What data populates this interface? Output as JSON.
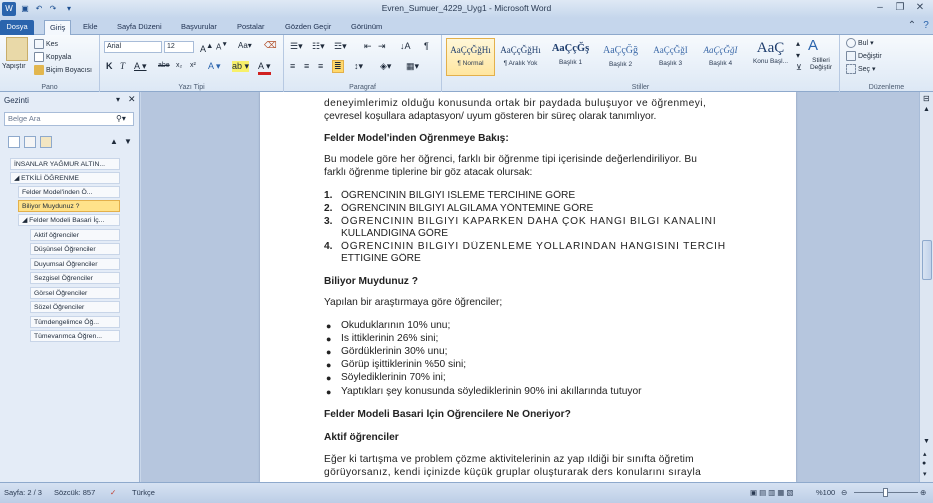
{
  "window": {
    "title": "Evren_Sumuer_4229_Uyg1 - Microsoft Word"
  },
  "qat": {
    "undo_tip": "1",
    "redo_tip": "2",
    "save_tip": "3"
  },
  "tabs": [
    {
      "label": "Dosya",
      "key": "D"
    },
    {
      "label": "Giriş",
      "key": "Ş"
    },
    {
      "label": "Ekle",
      "key": "O"
    },
    {
      "label": "Sayfa Düzeni",
      "key": "S"
    },
    {
      "label": "Başvurular",
      "key": "V"
    },
    {
      "label": "Postalar",
      "key": "L"
    },
    {
      "label": "Gözden Geçir",
      "key": "R"
    },
    {
      "label": "Görünüm",
      "key": "P"
    }
  ],
  "ribbon": {
    "clipboard": {
      "paste": "Yapıştır",
      "cut": "Kes",
      "copy": "Kopyala",
      "format_painter": "Biçim Boyacısı",
      "label": "Pano"
    },
    "font": {
      "family": "Arial",
      "size": "12",
      "label": "Yazı Tipi"
    },
    "paragraph": {
      "label": "Paragraf"
    },
    "styles": {
      "label": "Stiller",
      "items": [
        {
          "sample": "AaÇçĞğHı",
          "name": "¶ Normal"
        },
        {
          "sample": "AaÇçĞğHı",
          "name": "¶ Aralık Yok"
        },
        {
          "sample": "AaÇçĞş",
          "name": "Başlık 1"
        },
        {
          "sample": "AaÇçĞğ",
          "name": "Başlık 2"
        },
        {
          "sample": "AaÇçĞğI",
          "name": "Başlık 3"
        },
        {
          "sample": "AaÇçĞğI",
          "name": "Başlık 4"
        },
        {
          "sample": "AaÇ",
          "name": "Konu Başl..."
        }
      ],
      "change_styles": "Stilleri Değiştir"
    },
    "editing": {
      "find": "Bul",
      "replace": "Değiştir",
      "select": "Seç",
      "label": "Düzenleme"
    }
  },
  "nav": {
    "header": "Gezinti",
    "search_placeholder": "Belge Ara",
    "items": [
      "İNSANLAR YAĞMUR ALTIN...",
      "ETKİLİ ÖĞRENME",
      "Felder Model'inden Ö...",
      "Biliyor Muydunuz ?",
      "Felder Modeli Basari İç...",
      "Aktif öğrenciler",
      "Düşünsel Öğrenciler",
      "Duyumsal Öğrenciler",
      "Sezgisel Öğrenciler",
      "Görsel Öğrenciler",
      "Sözel Öğrenciler",
      "Tümdengelimce Öğ...",
      "Tümevarımca Öğren..."
    ]
  },
  "doc": {
    "lines": [
      "deneyimlerimiz olduğu konusunda ortak bir paydada buluşuyor ve öğrenmeyi,",
      "çevresel koşullara adaptasyon/ uyum gösteren bir süreç olarak tanımlıyor.",
      "Felder Model'inden Öğrenmeye Bakış:",
      "Bu modele göre her öğrenci, farklı bir öğrenme tipi içerisinde değerlendiriliyor. Bu",
      "farklı öğrenme tiplerine bir göz atacak olursak:",
      "ÖĞRENCININ BILGIYI ISLEME TERCIHINE GÖRE",
      "ÖĞRENCININ BILGIYI ALGILAMA YÖNTEMINE GÖRE",
      "ÖĞRENCININ BILGIYI KAPARKEN DAHA ÇOK HANGI BILGI KANALINI",
      "KULLANDIGINA GÖRE",
      "ÖĞRENCININ BILGIYI DÜZENLEME YOLLARINDAN HANGISINI TERCIH",
      "ETTIGINE GÖRE",
      "Biliyor Muydunuz ?",
      "Yapılan bir araştırmaya göre öğrenciler;",
      "Okuduklarının 10% unu;",
      "Is ittiklerinin 26% sini;",
      "Gördüklerinin 30% unu;",
      "Görüp işittiklerinin %50 sini;",
      "Söylediklerinin 70% ini;",
      "Yaptıkları şey konusunda söylediklerinin 90% ini akıllarında tutuyor",
      "Felder Modeli Basari İçin Öğrencilere Ne Öneriyor?",
      "Aktif öğrenciler",
      "Eğer ki tartışma ve problem çözme aktivitelerinin az yap ıldiği bir sınıfta öğretim",
      "görüyorsanız, kendi içinizde küçük gruplar oluşturarak ders konularını sırayla"
    ],
    "numbers": [
      "1.",
      "2.",
      "3.",
      "4."
    ]
  },
  "status": {
    "page": "Sayfa: 2 / 3",
    "words": "Sözcük: 857",
    "language": "Türkçe",
    "zoom": "%100",
    "zoom_level_percent": 100
  }
}
